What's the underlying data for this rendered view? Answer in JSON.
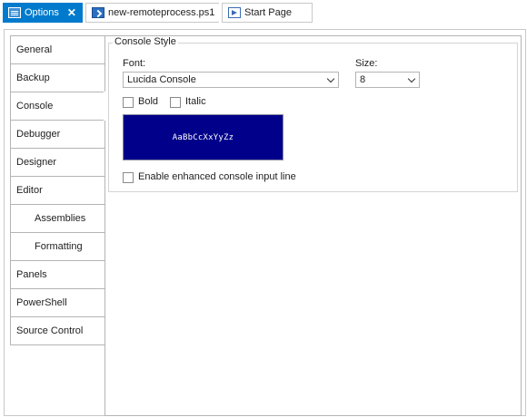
{
  "tabs": [
    {
      "label": "Options",
      "icon": "options-icon",
      "active": true,
      "close": "✕"
    },
    {
      "label": "new-remoteprocess.ps1",
      "icon": "powershell-file-icon",
      "active": false
    },
    {
      "label": "Start Page",
      "icon": "start-page-icon",
      "active": false
    }
  ],
  "nav": {
    "items": [
      {
        "label": "General"
      },
      {
        "label": "Backup"
      },
      {
        "label": "Console",
        "selected": true
      },
      {
        "label": "Debugger"
      },
      {
        "label": "Designer"
      },
      {
        "label": "Editor"
      },
      {
        "label": "Assemblies",
        "sub": true
      },
      {
        "label": "Formatting",
        "sub": true
      },
      {
        "label": "Panels"
      },
      {
        "label": "PowerShell"
      },
      {
        "label": "Source Control"
      }
    ]
  },
  "console_style": {
    "group_title": "Console Style",
    "font_label": "Font:",
    "font_value": "Lucida Console",
    "size_label": "Size:",
    "size_value": "8",
    "bold_label": "Bold",
    "bold_checked": false,
    "italic_label": "Italic",
    "italic_checked": false,
    "preview_text": "AaBbCcXxYyZz",
    "preview_bg": "#00008b",
    "preview_fg": "#ffffff",
    "enhanced_label": "Enable enhanced console input line",
    "enhanced_checked": false
  },
  "colors": {
    "accent": "#007acc"
  }
}
